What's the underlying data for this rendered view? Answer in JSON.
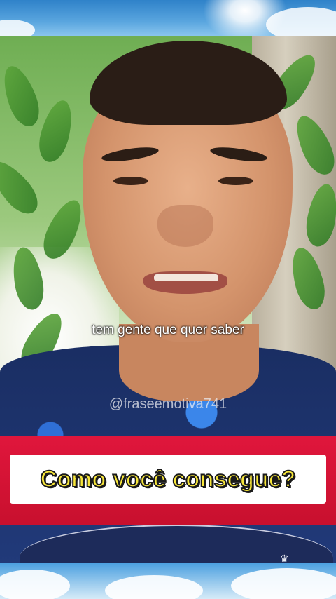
{
  "video": {
    "subtitle": "tem gente que quer saber",
    "watermark": "@fraseemotiva741"
  },
  "banner": {
    "text": "Como você consegue?",
    "background_color": "#d71436",
    "text_color": "#f7e63a"
  },
  "icons": {
    "crown": "crown-icon"
  }
}
